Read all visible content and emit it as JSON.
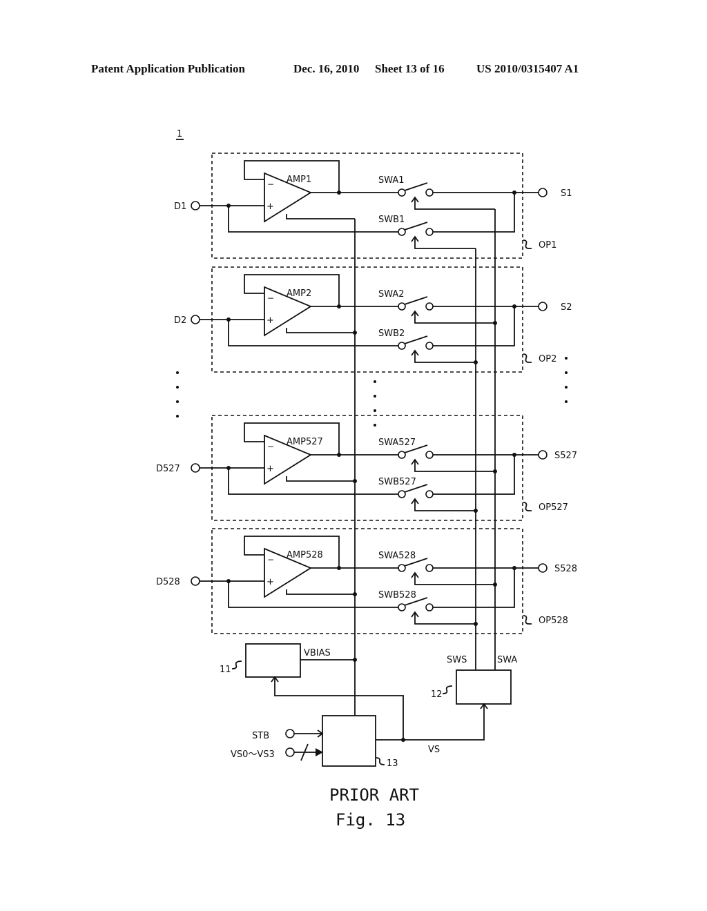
{
  "header": {
    "publication": "Patent Application Publication",
    "date": "Dec. 16, 2010",
    "sheet": "Sheet 13 of 16",
    "number": "US 2010/0315407 A1"
  },
  "figure": {
    "ref_label": "1",
    "caption_top": "PRIOR ART",
    "caption": "Fig. 13",
    "ellipsis": "· · · ·"
  },
  "channels": [
    {
      "input": "D1",
      "amp": "AMP1",
      "swa": "SWA1",
      "swb": "SWB1",
      "output": "S1",
      "block": "OP1"
    },
    {
      "input": "D2",
      "amp": "AMP2",
      "swa": "SWA2",
      "swb": "SWB2",
      "output": "S2",
      "block": "OP2"
    },
    {
      "input": "D527",
      "amp": "AMP527",
      "swa": "SWA527",
      "swb": "SWB527",
      "output": "S527",
      "block": "OP527"
    },
    {
      "input": "D528",
      "amp": "AMP528",
      "swa": "SWA528",
      "swb": "SWB528",
      "output": "S528",
      "block": "OP528"
    }
  ],
  "amp_signs": {
    "minus": "−",
    "plus": "+"
  },
  "control": {
    "bias_block": "11",
    "bias_signal": "VBIAS",
    "switch_ctrl_block": "12",
    "sws_signal": "SWS",
    "swa_signal": "SWA",
    "timing_block": "13",
    "stb_input": "STB",
    "vs_input": "VS0～VS3",
    "vs_signal": "VS"
  }
}
